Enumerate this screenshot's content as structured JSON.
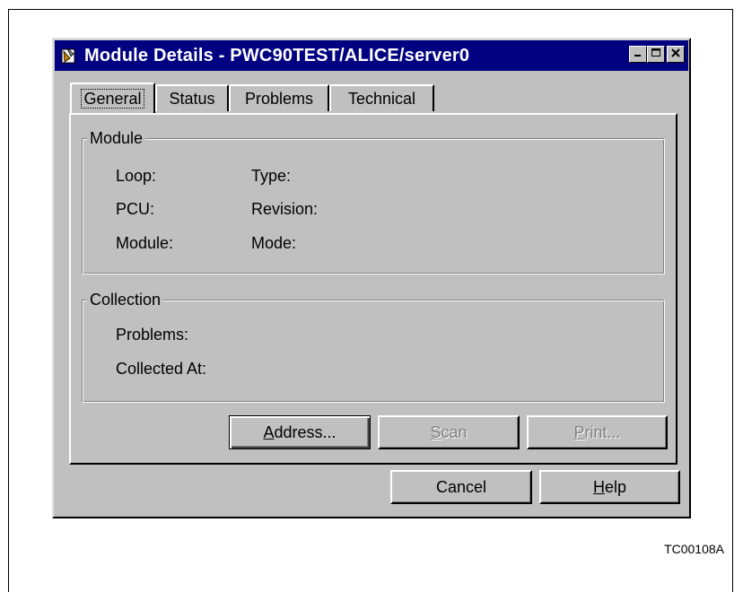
{
  "window": {
    "title": "Module Details - PWC90TEST/ALICE/server0"
  },
  "tabs": [
    {
      "label": "General"
    },
    {
      "label": "Status"
    },
    {
      "label": "Problems"
    },
    {
      "label": "Technical"
    }
  ],
  "module_group": {
    "legend": "Module",
    "loop_label": "Loop:",
    "type_label": "Type:",
    "pcu_label": "PCU:",
    "revision_label": "Revision:",
    "module_label": "Module:",
    "mode_label": "Mode:"
  },
  "collection_group": {
    "legend": "Collection",
    "problems_label": "Problems:",
    "collected_at_label": "Collected At:"
  },
  "buttons": {
    "address_mnemonic": "A",
    "address_rest": "ddress...",
    "scan_mnemonic": "S",
    "scan_rest": "can",
    "print_mnemonic": "P",
    "print_rest": "rint...",
    "cancel": "Cancel",
    "help_mnemonic": "H",
    "help_rest": "elp"
  },
  "caption": "TC00108A",
  "icons": [
    "app-icon",
    "minimize-icon",
    "maximize-icon",
    "close-icon"
  ],
  "colors": {
    "titlebar": "#000080",
    "face": "#c0c0c0",
    "disabled_text": "#808080"
  }
}
